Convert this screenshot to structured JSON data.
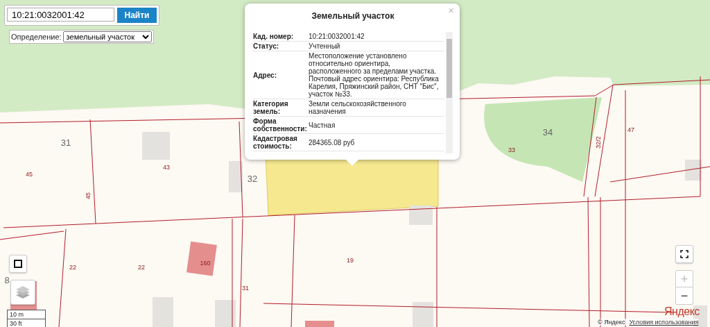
{
  "search": {
    "value": "10:21:0032001:42",
    "button": "Найти"
  },
  "definition": {
    "label": "Определение:",
    "value": "земельный участок"
  },
  "popup": {
    "close": "×",
    "title": "Земельный участок",
    "rows": [
      {
        "label": "Кад. номер:",
        "value": "10:21:0032001:42"
      },
      {
        "label": "Статус:",
        "value": "Учтенный"
      },
      {
        "label": "Адрес:",
        "value": "Местоположение установлено относительно ориентира, расположенного за пределами участка. Почтовый адрес ориентира: Республика Карелия, Пряжинский район, СНТ \"Бис\", участок №33."
      },
      {
        "label": "Категория земель:",
        "value": "Земли сельскохозяйственного назначения"
      },
      {
        "label": "Форма собственности:",
        "value": "Частная"
      },
      {
        "label": "Кадастровая стоимость:",
        "value": "284365.08 руб"
      }
    ]
  },
  "map": {
    "plot_labels": [
      {
        "text": "31",
        "kind": "area"
      },
      {
        "text": "45",
        "kind": "plot"
      },
      {
        "text": "45",
        "kind": "plot"
      },
      {
        "text": "43",
        "kind": "plot"
      },
      {
        "text": "32",
        "kind": "area"
      },
      {
        "text": "34",
        "kind": "area"
      },
      {
        "text": "33",
        "kind": "plot"
      },
      {
        "text": "32/2",
        "kind": "plot"
      },
      {
        "text": "47",
        "kind": "plot"
      },
      {
        "text": "22",
        "kind": "plot"
      },
      {
        "text": "22",
        "kind": "plot"
      },
      {
        "text": "160",
        "kind": "plot"
      },
      {
        "text": "31",
        "kind": "plot"
      },
      {
        "text": "19",
        "kind": "plot"
      },
      {
        "text": "8",
        "kind": "area"
      }
    ]
  },
  "controls": {
    "zoom_in": "+",
    "zoom_out": "−",
    "logo": "Яндекс"
  },
  "scale": {
    "metric": "10 m",
    "imperial": "30 ft"
  },
  "attribution": {
    "copyright": "© Яндекс",
    "terms": "Условия использования"
  }
}
